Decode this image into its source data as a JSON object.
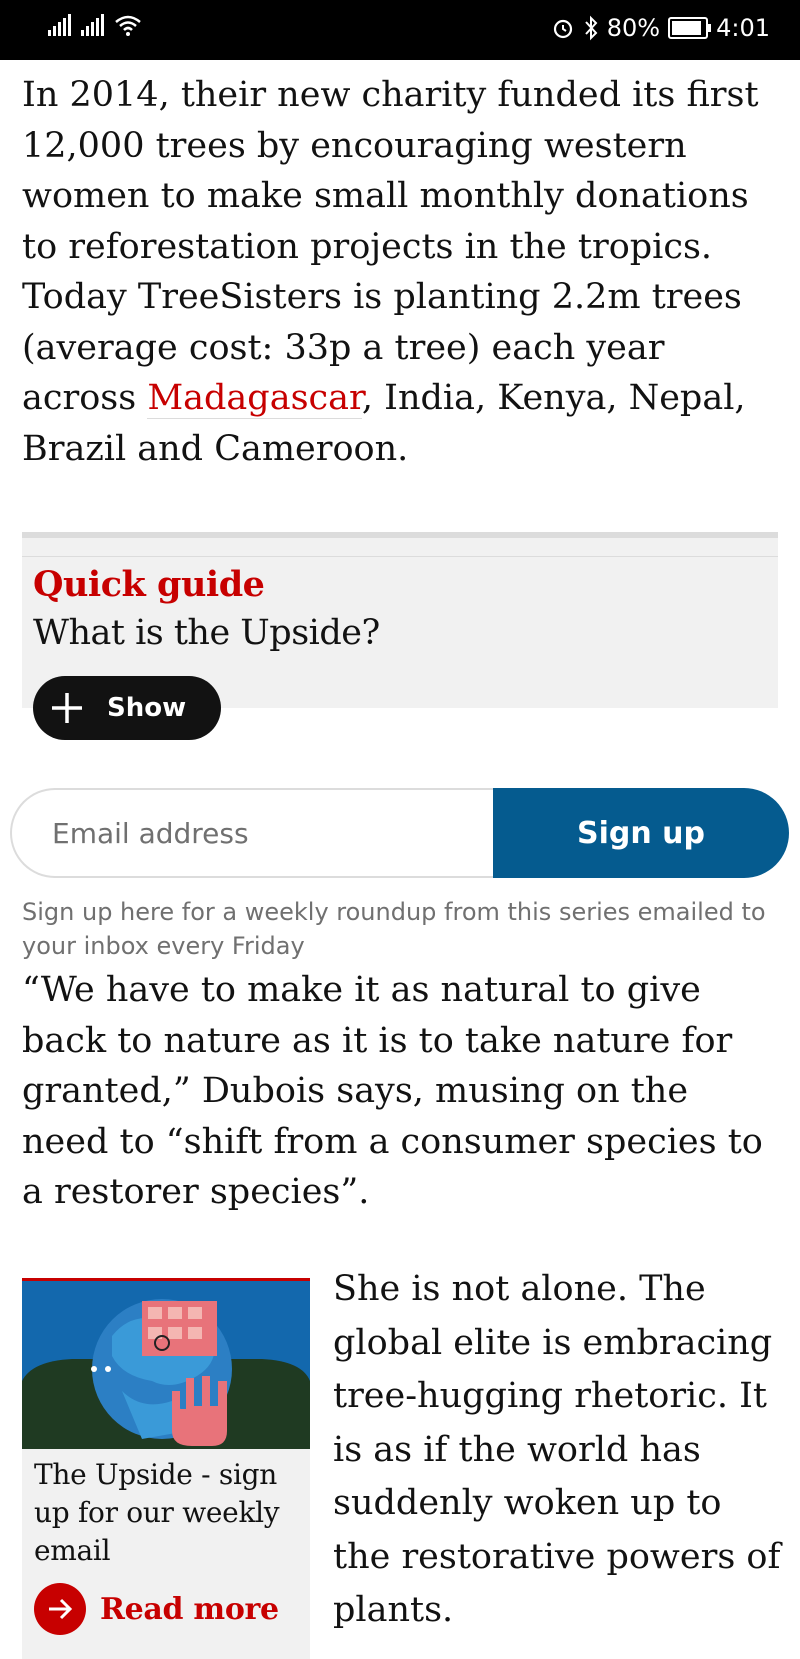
{
  "status_bar": {
    "battery": "80%",
    "time": "4:01",
    "icons": [
      "signal-icon",
      "signal-icon",
      "wifi-icon",
      "alarm-icon",
      "bluetooth-icon",
      "battery-icon"
    ]
  },
  "article": {
    "para1_before_link": "In 2014, their new charity funded its first 12,000 trees by encouraging western women to make small monthly donations to reforestation projects in the tropics. Today TreeSisters is planting 2.2m trees (average cost: 33p a tree) each year across ",
    "para1_link": "Madagascar",
    "para1_after_link": ", India, Kenya, Nepal, Brazil and Cameroon.",
    "quote_para": "“We have to make it as natural to give back to nature as it is to take nature for granted,” Dubois says, musing on the need to “shift from a consumer species to a restorer species”.",
    "side_para": "She is not alone. The global elite is embracing tree-hugging rhetoric. It is as if the world has suddenly woken up to the restorative powers of plants."
  },
  "quick_guide": {
    "kicker": "Quick guide",
    "title": "What is the Upside?",
    "show_label": "Show"
  },
  "signup": {
    "email_placeholder": "Email address",
    "button_label": "Sign up",
    "note": "Sign up here for a weekly roundup from this series emailed to your inbox every Friday"
  },
  "promo": {
    "title": "The Upside - sign up for our weekly email",
    "read_more": "Read more"
  },
  "colors": {
    "accent_red": "#c70000",
    "signup_blue": "#055b8f",
    "guide_bg": "#f1f1f1"
  }
}
